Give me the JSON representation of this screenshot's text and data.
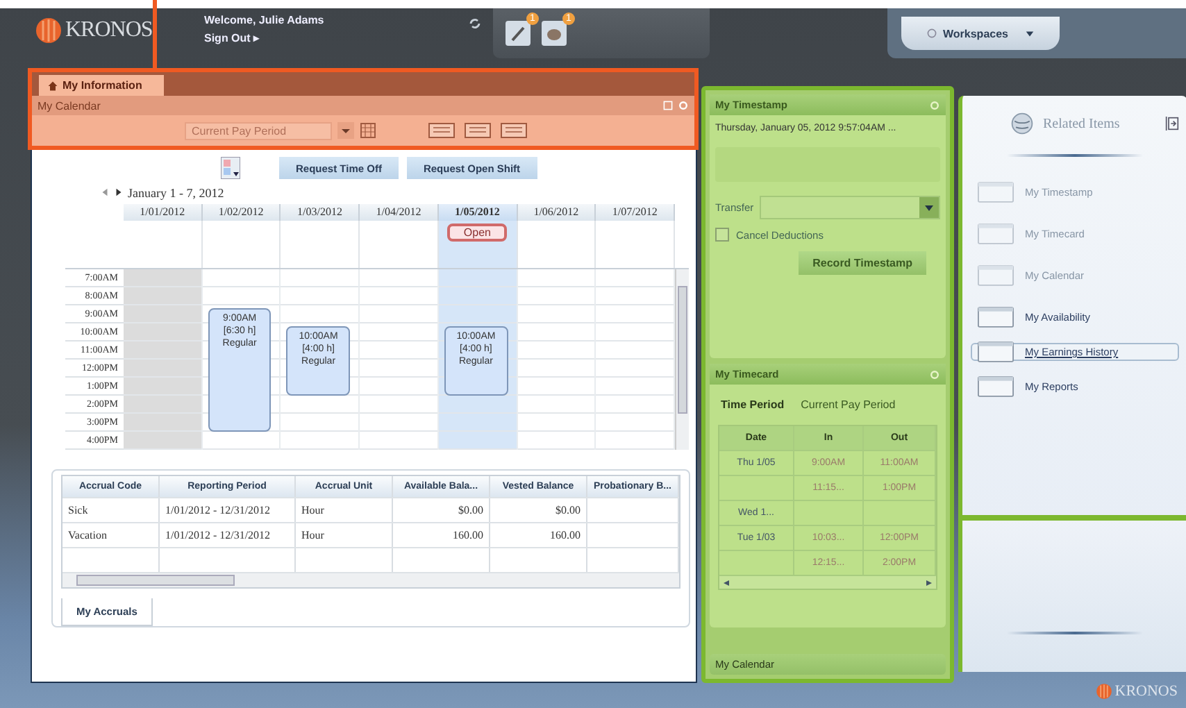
{
  "header": {
    "logo": "KRONOS",
    "welcome": "Welcome, Julie Adams",
    "sign_out": "Sign Out ▸",
    "notifications": [
      {
        "badge": "1"
      },
      {
        "badge": "1"
      }
    ],
    "workspaces": "Workspaces"
  },
  "tabs": [
    {
      "label": "My Information",
      "selected": true
    }
  ],
  "calendar": {
    "title": "My Calendar",
    "period": "Current Pay Period",
    "buttons": [
      "Request Time Off",
      "Request Open Shift"
    ],
    "range": "January 1 - 7, 2012",
    "days": [
      {
        "label": "1/01/2012",
        "today": false,
        "weekend": true
      },
      {
        "label": "1/02/2012",
        "today": false,
        "weekend": false,
        "events": [
          {
            "time": "9:00AM",
            "duration": "[6:30 h]",
            "type": "Regular"
          }
        ]
      },
      {
        "label": "1/03/2012",
        "today": false,
        "weekend": false,
        "events": [
          {
            "time": "10:00AM",
            "duration": "[4:00 h]",
            "type": "Regular"
          }
        ]
      },
      {
        "label": "1/04/2012",
        "today": false,
        "weekend": false
      },
      {
        "label": "1/05/2012",
        "today": true,
        "weekend": false,
        "open": "Open",
        "events": [
          {
            "time": "10:00AM",
            "duration": "[4:00 h]",
            "type": "Regular"
          }
        ]
      },
      {
        "label": "1/06/2012",
        "today": false,
        "weekend": false
      },
      {
        "label": "1/07/2012",
        "today": false,
        "weekend": false
      }
    ],
    "slots": [
      "7:00AM",
      "8:00AM",
      "9:00AM",
      "10:00AM",
      "11:00AM",
      "12:00PM",
      "1:00PM",
      "2:00PM",
      "3:00PM",
      "4:00PM"
    ]
  },
  "accruals": {
    "tab": "My Accruals",
    "columns": [
      "Accrual Code",
      "Reporting Period",
      "Accrual Unit",
      "Available Bala...",
      "Vested Balance",
      "Probationary B..."
    ],
    "rows": [
      [
        "Sick",
        "1/01/2012 - 12/31/2012",
        "Hour",
        "$0.00",
        "$0.00",
        ""
      ],
      [
        "Vacation",
        "1/01/2012 - 12/31/2012",
        "Hour",
        "160.00",
        "160.00",
        ""
      ]
    ]
  },
  "timestamp": {
    "title": "My Timestamp",
    "datetime": "Thursday, January 05, 2012 9:57:04AM ...",
    "transfer_label": "Transfer",
    "cancel_deductions": {
      "label": "Cancel Deductions",
      "checked": false
    },
    "button": "Record Timestamp"
  },
  "timecard": {
    "title": "My Timecard",
    "period_label": "Time Period",
    "period": "Current Pay Period",
    "columns": [
      "Date",
      "In",
      "Out"
    ],
    "rows": [
      [
        "Thu 1/05",
        "9:00AM",
        "11:00AM"
      ],
      [
        "",
        "11:15...",
        "1:00PM"
      ],
      [
        "Wed 1...",
        "",
        ""
      ],
      [
        "Tue 1/03",
        "10:03...",
        "12:00PM"
      ],
      [
        "",
        "12:15...",
        "2:00PM"
      ]
    ]
  },
  "collapsed_panel": {
    "title": "My Calendar"
  },
  "related": {
    "title": "Related Items",
    "items": [
      {
        "label": "My Timestamp",
        "disabled": true,
        "selected": false
      },
      {
        "label": "My Timecard",
        "disabled": true,
        "selected": false
      },
      {
        "label": "My Calendar",
        "disabled": true,
        "selected": false
      },
      {
        "label": "My Availability",
        "disabled": false,
        "selected": false
      },
      {
        "label": "My Earnings History",
        "disabled": false,
        "selected": true
      },
      {
        "label": "My Reports",
        "disabled": false,
        "selected": false
      }
    ]
  },
  "footer": {
    "logo": "KRONOS"
  }
}
